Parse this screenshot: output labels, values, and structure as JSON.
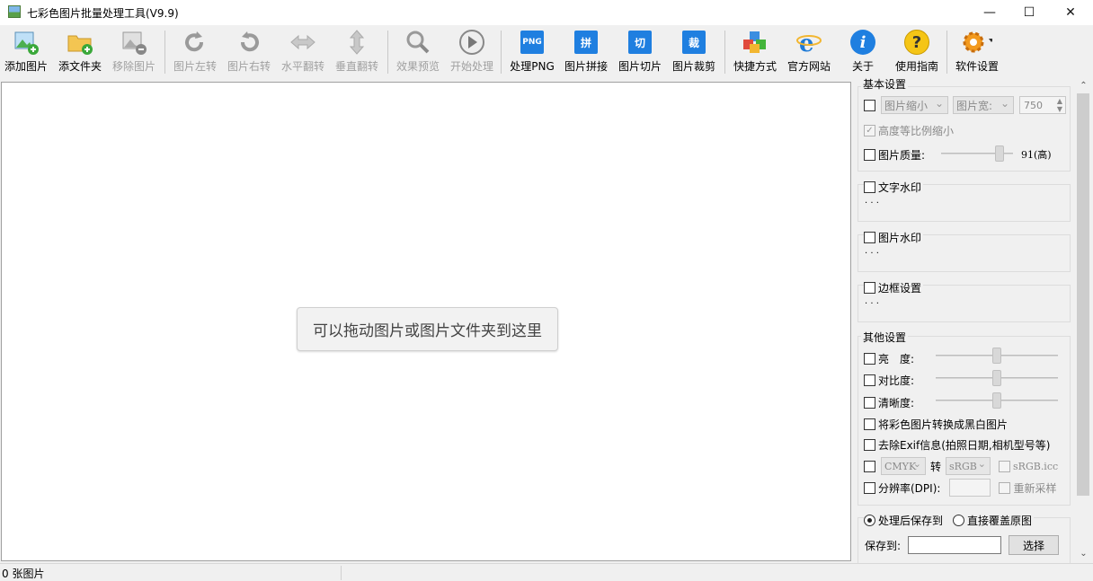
{
  "window": {
    "title": "七彩色图片批量处理工具(V9.9)",
    "minimize": "—",
    "maximize": "☐",
    "close": "✕"
  },
  "toolbar": [
    {
      "label": "添加图片",
      "icon": "add-image-icon",
      "enabled": true
    },
    {
      "label": "添文件夹",
      "icon": "add-folder-icon",
      "enabled": true
    },
    {
      "label": "移除图片",
      "icon": "remove-image-icon",
      "enabled": false
    },
    {
      "label": "图片左转",
      "icon": "rotate-left-icon",
      "enabled": false
    },
    {
      "label": "图片右转",
      "icon": "rotate-right-icon",
      "enabled": false
    },
    {
      "label": "水平翻转",
      "icon": "flip-horizontal-icon",
      "enabled": false
    },
    {
      "label": "垂直翻转",
      "icon": "flip-vertical-icon",
      "enabled": false
    },
    {
      "label": "效果预览",
      "icon": "preview-icon",
      "enabled": false
    },
    {
      "label": "开始处理",
      "icon": "play-icon",
      "enabled": false
    },
    {
      "label": "处理PNG",
      "icon": "png-icon",
      "badge": "PNG",
      "enabled": true
    },
    {
      "label": "图片拼接",
      "icon": "merge-icon",
      "badge": "拼",
      "enabled": true
    },
    {
      "label": "图片切片",
      "icon": "slice-icon",
      "badge": "切",
      "enabled": true
    },
    {
      "label": "图片裁剪",
      "icon": "crop-icon",
      "badge": "裁",
      "enabled": true
    },
    {
      "label": "快捷方式",
      "icon": "shortcut-icon",
      "enabled": true
    },
    {
      "label": "官方网站",
      "icon": "ie-icon",
      "enabled": true
    },
    {
      "label": "关于",
      "icon": "info-icon",
      "badge": "i",
      "enabled": true
    },
    {
      "label": "使用指南",
      "icon": "help-icon",
      "badge": "?",
      "enabled": true
    },
    {
      "label": "软件设置",
      "icon": "settings-icon",
      "enabled": true
    }
  ],
  "canvas": {
    "drop_hint": "可以拖动图片或图片文件夹到这里"
  },
  "status": {
    "count": "0 张图片"
  },
  "panel": {
    "basic": {
      "title": "基本设置",
      "resize_mode": "图片缩小",
      "dimension": "图片宽:",
      "width_value": "750",
      "keep_ratio": "高度等比例缩小",
      "quality_label": "图片质量:",
      "quality_value": "91(高)",
      "quality_level": 0.91
    },
    "text_watermark": {
      "title": "文字水印",
      "dots": "· · ·"
    },
    "image_watermark": {
      "title": "图片水印",
      "dots": "· · ·"
    },
    "border": {
      "title": "边框设置",
      "dots": "· · ·"
    },
    "other": {
      "title": "其他设置",
      "brightness": "亮　度:",
      "contrast": "对比度:",
      "sharpness": "清晰度:",
      "grayscale": "将彩色图片转换成黑白图片",
      "remove_exif": "去除Exif信息(拍照日期,相机型号等)",
      "color_from": "CMYK",
      "to": "转",
      "color_to": "sRGB",
      "icc": "sRGB.icc",
      "dpi_label": "分辨率(DPI):",
      "resample": "重新采样"
    },
    "save": {
      "opt_save": "处理后保存到",
      "opt_overwrite": "直接覆盖原图",
      "save_to": "保存到:",
      "choose": "选择"
    }
  }
}
